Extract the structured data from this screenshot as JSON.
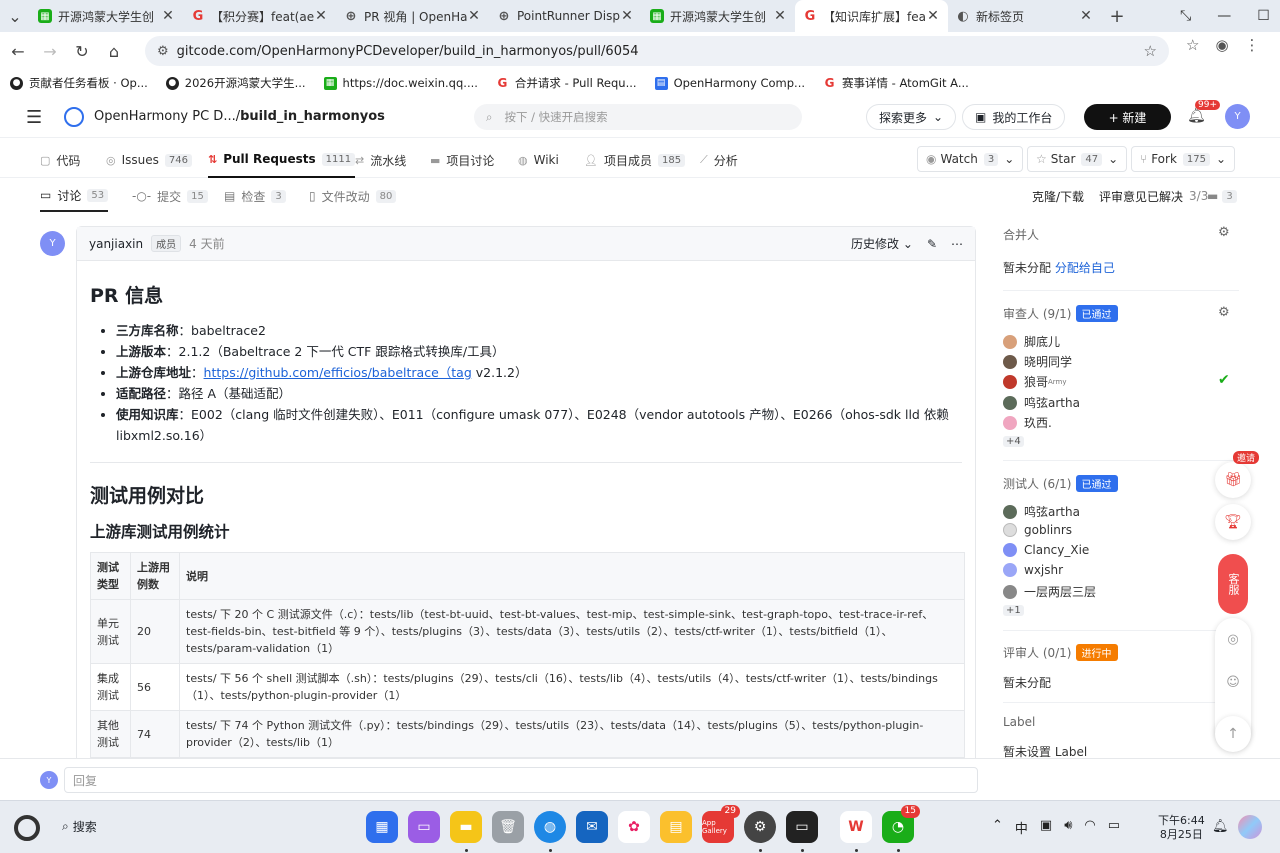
{
  "browser": {
    "tabs": [
      {
        "title": "开源鸿蒙大学生创",
        "icon_color": "#1aad19",
        "icon": "sheet-icon"
      },
      {
        "title": "【积分赛】feat(aet",
        "icon_color": "#e53935",
        "icon": "gitcode-icon"
      },
      {
        "title": "PR 视角 | OpenHar",
        "icon_color": "#555",
        "icon": "globe-icon"
      },
      {
        "title": "PointRunner Displ",
        "icon_color": "#555",
        "icon": "globe-icon"
      },
      {
        "title": "开源鸿蒙大学生创",
        "icon_color": "#1aad19",
        "icon": "sheet-icon"
      },
      {
        "title": "【知识库扩展】fea",
        "icon_color": "#e53935",
        "icon": "gitcode-icon"
      },
      {
        "title": "新标签页",
        "icon_color": "#555",
        "icon": "newtab-icon"
      }
    ],
    "url": "gitcode.com/OpenHarmonyPCDeveloper/build_in_harmonyos/pull/6054",
    "bookmarks": [
      {
        "label": "贡献者任务看板 · Op...",
        "color": "#222"
      },
      {
        "label": "2026开源鸿蒙大学生...",
        "color": "#222"
      },
      {
        "label": "https://doc.weixin.qq....",
        "color": "#1aad19"
      },
      {
        "label": "合并请求 - Pull Requ...",
        "color": "#e53935"
      },
      {
        "label": "OpenHarmony Comp...",
        "color": "#2f6fed"
      },
      {
        "label": "赛事详情 - AtomGit A...",
        "color": "#e53935"
      }
    ]
  },
  "site": {
    "repo_path_prefix": "OpenHarmony PC D.../",
    "repo_name": "build_in_harmonyos",
    "search_placeholder": "按下 / 快速开启搜索",
    "explore": "探索更多",
    "workbench": "我的工作台",
    "new_button": "+ 新建",
    "notif_count": "99+",
    "avatar": "Y"
  },
  "repo_nav": {
    "items": [
      {
        "label": "代码",
        "count": ""
      },
      {
        "label": "Issues",
        "count": "746"
      },
      {
        "label": "Pull Requests",
        "count": "1111"
      },
      {
        "label": "流水线",
        "count": ""
      },
      {
        "label": "项目讨论",
        "count": ""
      },
      {
        "label": "Wiki",
        "count": ""
      },
      {
        "label": "项目成员",
        "count": "185"
      },
      {
        "label": "分析",
        "count": ""
      }
    ],
    "watch": {
      "label": "Watch",
      "count": "3"
    },
    "star": {
      "label": "Star",
      "count": "47"
    },
    "fork": {
      "label": "Fork",
      "count": "175"
    }
  },
  "pr_tabs": {
    "items": [
      {
        "label": "讨论",
        "count": "53"
      },
      {
        "label": "提交",
        "count": "15"
      },
      {
        "label": "检查",
        "count": "3"
      },
      {
        "label": "文件改动",
        "count": "80"
      }
    ],
    "clone": "克隆/下载",
    "review_resolved": "评审意见已解决",
    "review_ratio": "3/3",
    "comment_count": "3"
  },
  "comment": {
    "author": "yanjiaxin",
    "role": "成员",
    "time": "4 天前",
    "history": "历史修改",
    "h1": "PR 信息",
    "items": [
      {
        "key": "三方库名称",
        "value": "babeltrace2"
      },
      {
        "key": "上游版本",
        "value": "2.1.2（Babeltrace 2 下一代 CTF 跟踪格式转换库/工具）"
      },
      {
        "key": "上游仓库地址",
        "link": "https://github.com/efficios/babeltrace（tag",
        "value_after": " v2.1.2）"
      },
      {
        "key": "适配路径",
        "value": "路径 A（基础适配）"
      },
      {
        "key": "使用知识库",
        "value": "E002（clang 临时文件创建失败）、E011（configure umask 077）、E0248（vendor autotools 产物）、E0266（ohos-sdk lld 依赖 libxml2.so.16）"
      }
    ],
    "h1b": "测试用例对比",
    "h2": "上游库测试用例统计",
    "table": {
      "headers": [
        "测试类型",
        "上游用例数",
        "说明"
      ],
      "rows": [
        [
          "单元测试",
          "20",
          "tests/ 下 20 个 C 测试源文件（.c）：tests/lib（test-bt-uuid、test-bt-values、test-mip、test-simple-sink、test-graph-topo、test-trace-ir-ref、test-fields-bin、test-bitfield 等 9 个）、tests/plugins（3）、tests/data（3）、tests/utils（2）、tests/ctf-writer（1）、tests/bitfield（1）、tests/param-validation（1）"
        ],
        [
          "集成测试",
          "56",
          "tests/ 下 56 个 shell 测试脚本（.sh）：tests/plugins（29）、tests/cli（16）、tests/lib（4）、tests/utils（4）、tests/ctf-writer（1）、tests/bindings（1）、tests/python-plugin-provider（1）"
        ],
        [
          "其他测试",
          "74",
          "tests/ 下 74 个 Python 测试文件（.py）：tests/bindings（29）、tests/utils（23）、tests/data（14）、tests/plugins（5）、tests/python-plugin-provider（2）、tests/lib（1）"
        ]
      ]
    }
  },
  "sidebar": {
    "merger": {
      "label": "合并人",
      "value": "暂未分配",
      "assign": "分配给自己"
    },
    "reviewers": {
      "label": "审查人 (9/1)",
      "status": "已通过",
      "names": [
        "脚底儿",
        "晓明同学",
        "狼哥",
        "鸣弦artha",
        "玖西."
      ],
      "more": "+4"
    },
    "testers": {
      "label": "测试人 (6/1)",
      "status": "已通过",
      "names": [
        "鸣弦artha",
        "goblinrs",
        "Clancy_Xie",
        "wxjshr",
        "一层两层三层"
      ],
      "more": "+1"
    },
    "reviewer2": {
      "label": "评审人 (0/1)",
      "status": "进行中",
      "value": "暂未分配"
    },
    "label": {
      "label": "Label",
      "value": "暂未设置 Label"
    },
    "army_sup": "Army",
    "float_labels": {
      "invite": "邀请",
      "service": "客服"
    }
  },
  "reply": {
    "placeholder": "回复",
    "avatar": "Y"
  },
  "taskbar": {
    "search": "搜索",
    "time": "下午6:44",
    "date": "8月25日",
    "badge_appgallery": "29",
    "badge_wechat": "15",
    "appgallery_label": "App Gallery",
    "ime": "中"
  },
  "colors": {
    "accent": "#1d63d8",
    "passed": "#2f6fed",
    "progress": "#f57c00",
    "primary_btn": "#111111",
    "check": "#1aad19"
  }
}
